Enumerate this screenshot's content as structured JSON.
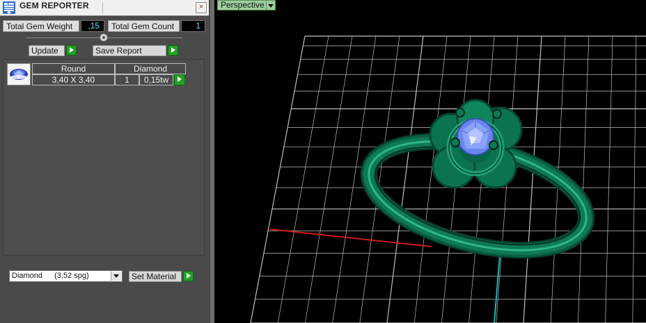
{
  "panel": {
    "title": "GEM REPORTER",
    "close_label": "×",
    "total_weight_label": "Total Gem Weight",
    "total_weight_value": ",15",
    "total_count_label": "Total Gem Count",
    "total_count_value": "1",
    "update_label": "Update",
    "save_report_label": "Save Report"
  },
  "gem_table": {
    "headers": [
      "Round",
      "Diamond"
    ],
    "row": {
      "size": "3,40 X 3,40",
      "count": "1",
      "weight": "0,15tw"
    }
  },
  "material": {
    "selected_name": "Diamond",
    "selected_spg": "(3,52 spg)",
    "set_material_label": "Set Material"
  },
  "viewport": {
    "view_name": "Perspective"
  },
  "colors": {
    "ring_metal": "#0e7a55",
    "gem": "#7f9bf5",
    "x_axis": "#cc1a1a",
    "y_axis": "#1ab8c0",
    "grid": "#bfbfbf"
  }
}
